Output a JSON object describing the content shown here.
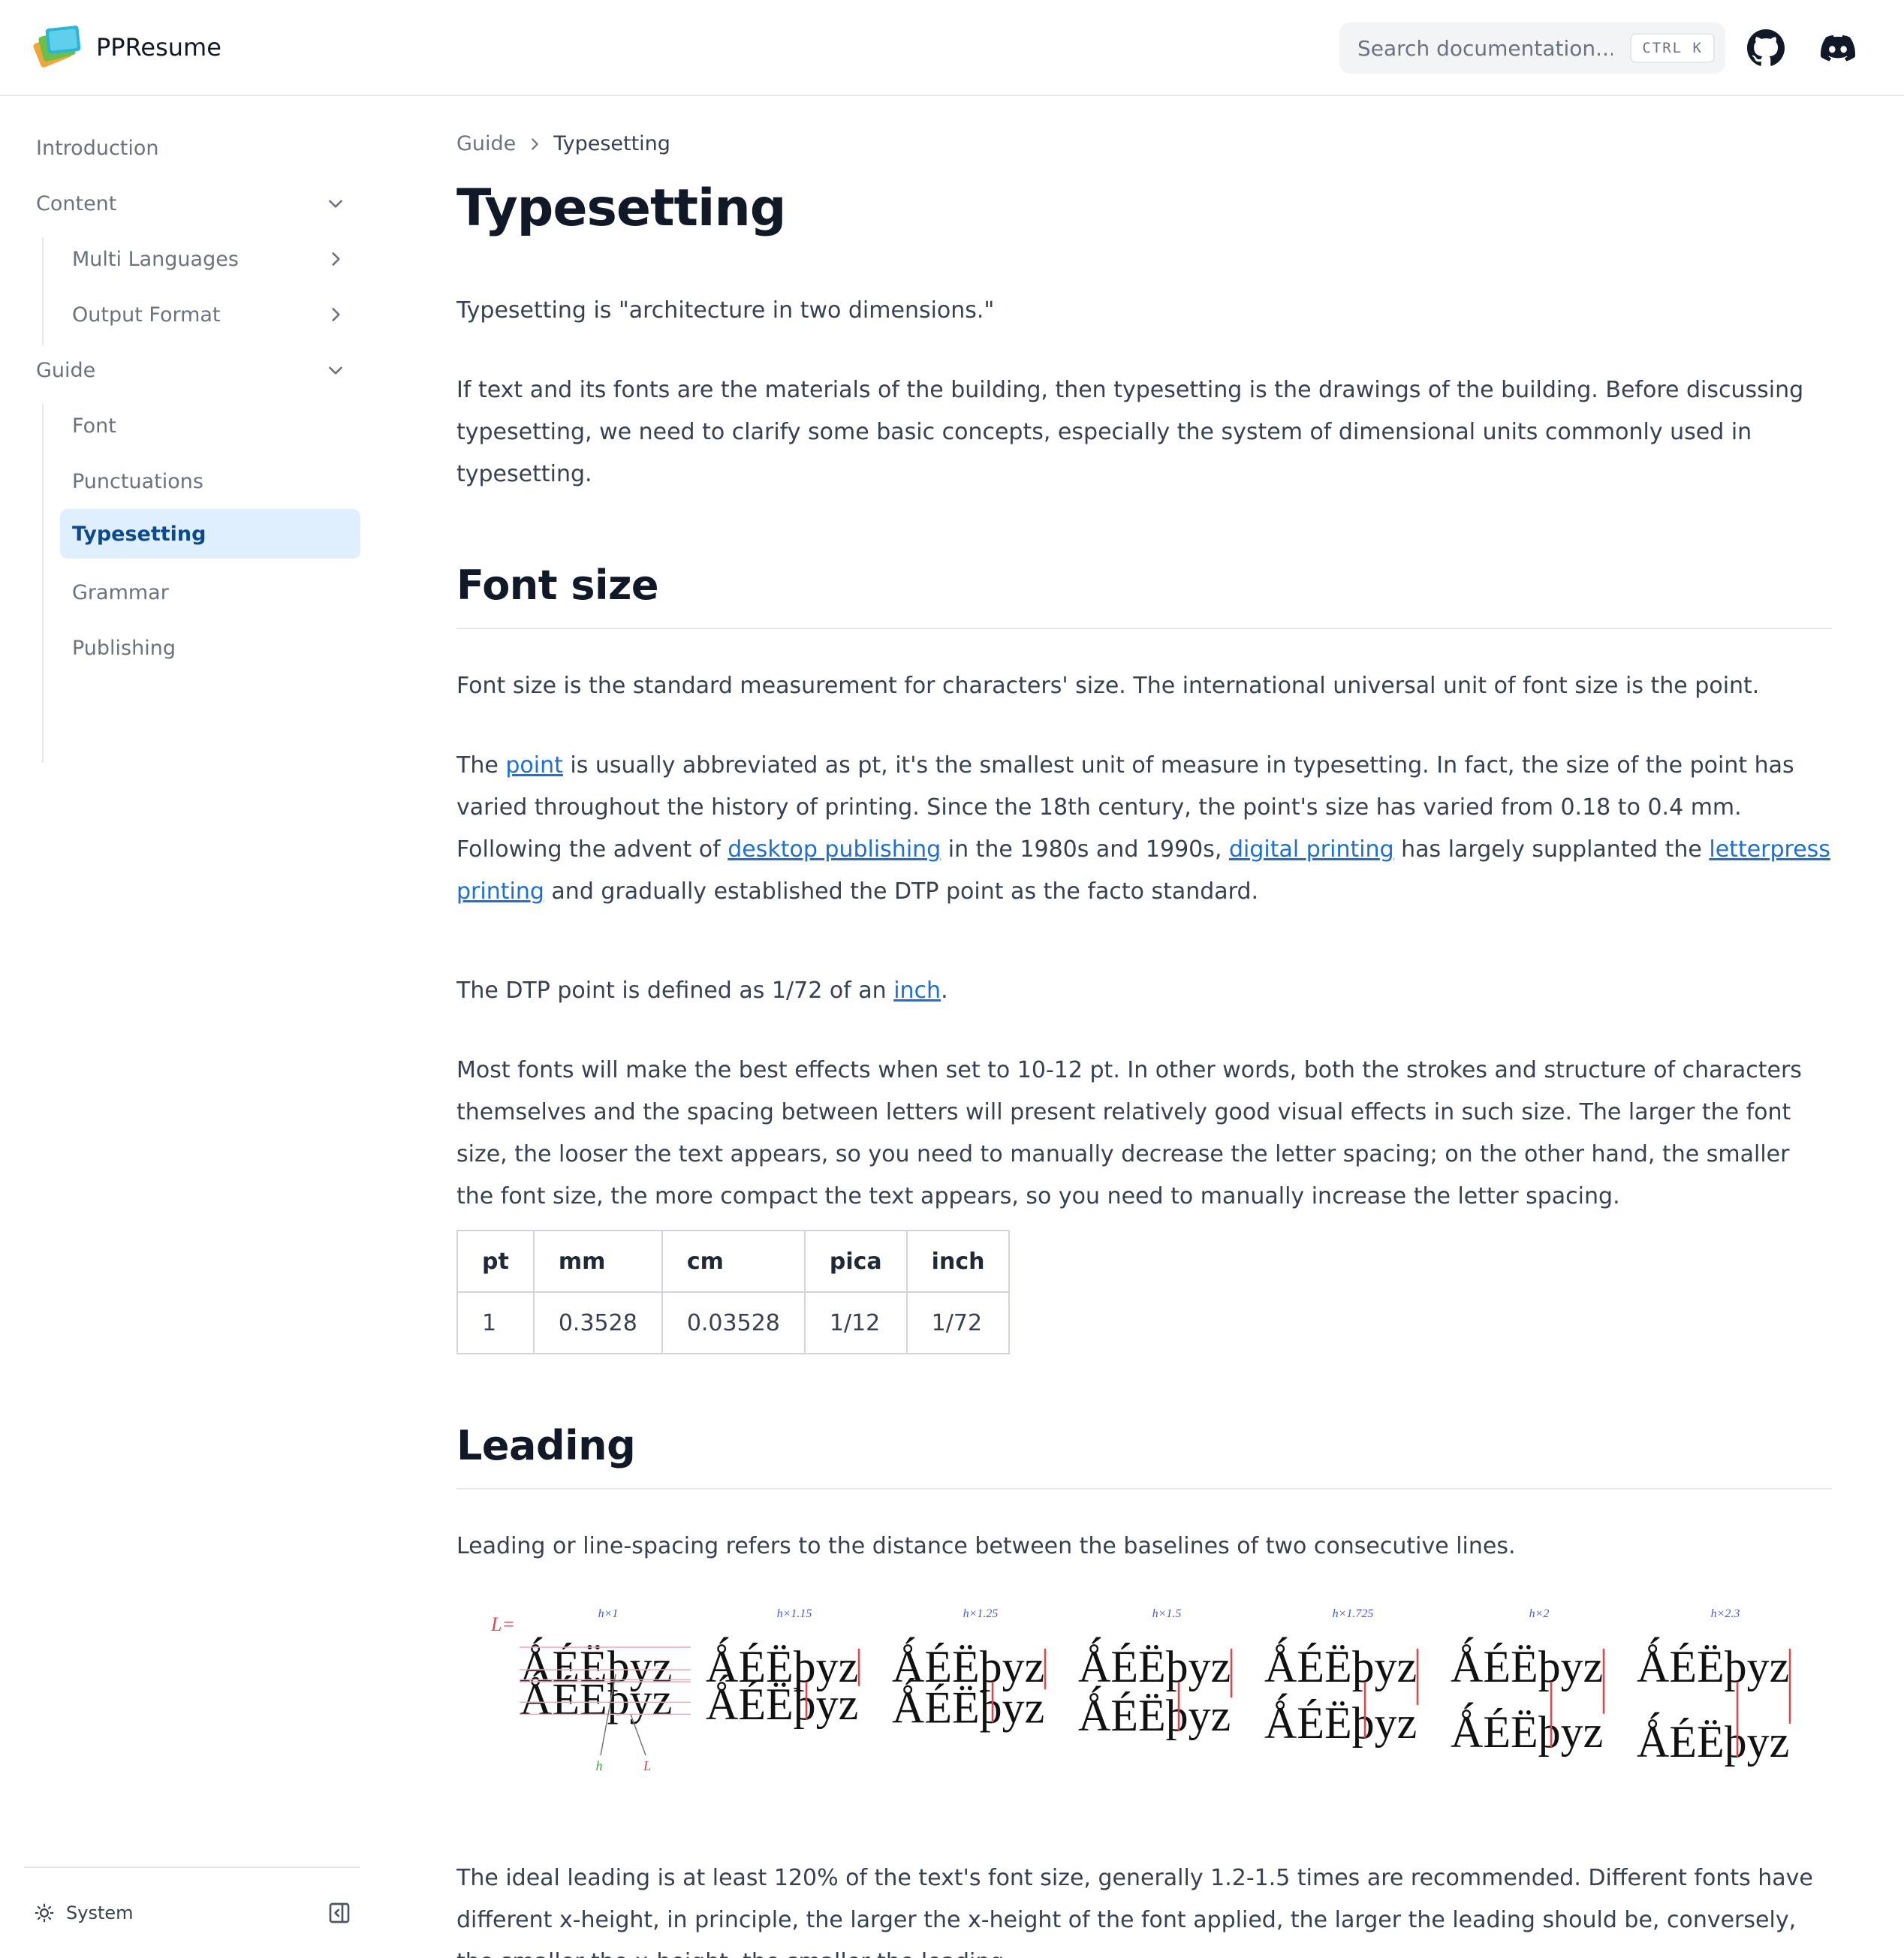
{
  "header": {
    "brand": "PPResume",
    "search_placeholder": "Search documentation...",
    "shortcut": "CTRL K",
    "icons": [
      "github-icon",
      "discord-icon"
    ]
  },
  "sidebar": {
    "items": [
      {
        "label": "Introduction"
      },
      {
        "label": "Content",
        "expanded": true
      },
      {
        "label": "Multi Languages"
      },
      {
        "label": "Output Format"
      },
      {
        "label": "Guide",
        "expanded": true
      },
      {
        "label": "Font"
      },
      {
        "label": "Punctuations"
      },
      {
        "label": "Typesetting",
        "active": true
      },
      {
        "label": "Grammar"
      },
      {
        "label": "Publishing"
      }
    ],
    "theme_label": "System"
  },
  "breadcrumb": {
    "parent": "Guide",
    "current": "Typesetting"
  },
  "page": {
    "title": "Typesetting",
    "intro": "Typesetting is \"architecture in two dimensions.\"",
    "intro2": "If text and its fonts are the materials of the building, then typesetting is the drawings of the building. Before discussing typesetting, we need to clarify some basic concepts, especially the system of dimensional units commonly used in typesetting.",
    "font_size": {
      "heading": "Font size",
      "p1": "Font size is the standard measurement for characters' size. The international universal unit of font size is the point.",
      "p2": {
        "t1": "The ",
        "link_point": "point",
        "t2": " is usually abbreviated as pt, it's the smallest unit of measure in typesetting. In fact, the size of the point has varied throughout the history of printing. Since the 18th century, the point's size has varied from 0.18 to 0.4 mm. Following the advent of ",
        "link_dtp": "desktop publishing",
        "t3": " in the 1980s and 1990s, ",
        "link_digital": "digital printing",
        "t4": " has largely supplanted the ",
        "link_letterpress": "letterpress printing",
        "t5": " and gradually established the DTP point as the facto standard."
      },
      "p3": {
        "t1": "The DTP point is defined as 1/72 of an ",
        "link_inch": "inch",
        "t2": "."
      },
      "p4": "Most fonts will make the best effects when set to 10-12 pt. In other words, both the strokes and structure of characters themselves and the spacing between letters will present relatively good visual effects in such size. The larger the font size, the looser the text appears, so you need to manually decrease the letter spacing; on the other hand, the smaller the font size, the more compact the text appears, so you need to manually increase the letter spacing.",
      "table": {
        "headers": [
          "pt",
          "mm",
          "cm",
          "pica",
          "inch"
        ],
        "row": [
          "1",
          "0.3528",
          "0.03528",
          "1/12",
          "1/72"
        ]
      }
    },
    "leading": {
      "heading": "Leading",
      "p1": "Leading or line-spacing refers to the distance between the baselines of two consecutive lines.",
      "figure": {
        "label_L": "L=",
        "sample": "ǺÉËþyz",
        "multipliers": [
          "h×1",
          "h×1.15",
          "h×1.25",
          "h×1.5",
          "h×1.725",
          "h×2",
          "h×2.3"
        ],
        "factors": [
          1,
          1.15,
          1.25,
          1.5,
          1.725,
          2,
          2.3
        ],
        "legend_h": "h",
        "legend_L": "L"
      },
      "p2": "The ideal leading is at least 120% of the text's font size, generally 1.2-1.5 times are recommended. Different fonts have different x-height, in principle, the larger the x-height of the font applied, the larger the leading should be, conversely, the smaller the x-height, the smaller the leading."
    }
  },
  "colors": {
    "accent": "#1d6fd4",
    "active_bg": "#e0effe",
    "active_text": "#0c4a8f",
    "figure_red": "#e0474c",
    "figure_blue": "#4a58d6",
    "figure_green": "#3aa64a"
  }
}
